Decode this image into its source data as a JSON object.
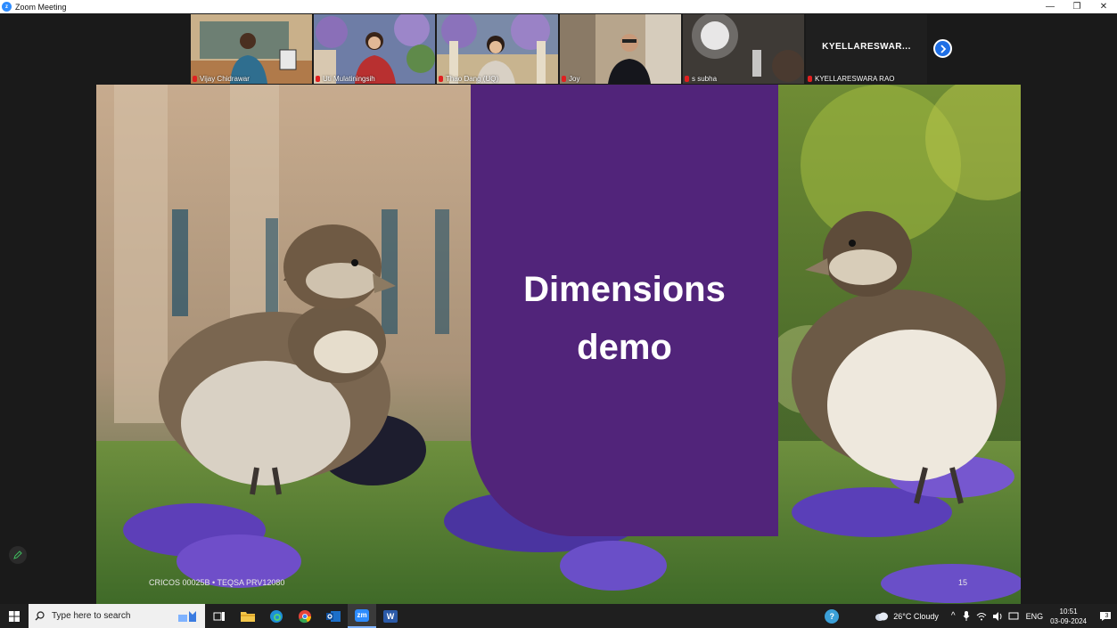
{
  "window": {
    "title": "Zoom Meeting",
    "minimize_glyph": "—",
    "restore_glyph": "❐",
    "close_glyph": "✕"
  },
  "participants": [
    {
      "name": "Vijay Chidrawar",
      "muted": true
    },
    {
      "name": "Uti Mulatiningsih",
      "muted": true
    },
    {
      "name": "Thao Dang (UQ)",
      "muted": true
    },
    {
      "name": "Joy",
      "muted": true
    },
    {
      "name": "s subha",
      "muted": true
    },
    {
      "name": "KYELLARESWARA RAO",
      "muted": true,
      "display_text": "KYELLARESWAR..."
    }
  ],
  "slide": {
    "title_line1": "Dimensions",
    "title_line2": "demo",
    "footer_left": "CRICOS 00025B • TEQSA PRV12080",
    "page_number": "15",
    "panel_color": "#51247a"
  },
  "taskbar": {
    "search_placeholder": "Type here to search",
    "zoom_label": "zm",
    "word_label": "W",
    "weather": "26°C  Cloudy",
    "language": "ENG",
    "time": "10:51",
    "date": "03-09-2024",
    "notifications_count": "3"
  },
  "colors": {
    "zoom_blue": "#2d8cff",
    "next_button": "#1f6fe5"
  }
}
